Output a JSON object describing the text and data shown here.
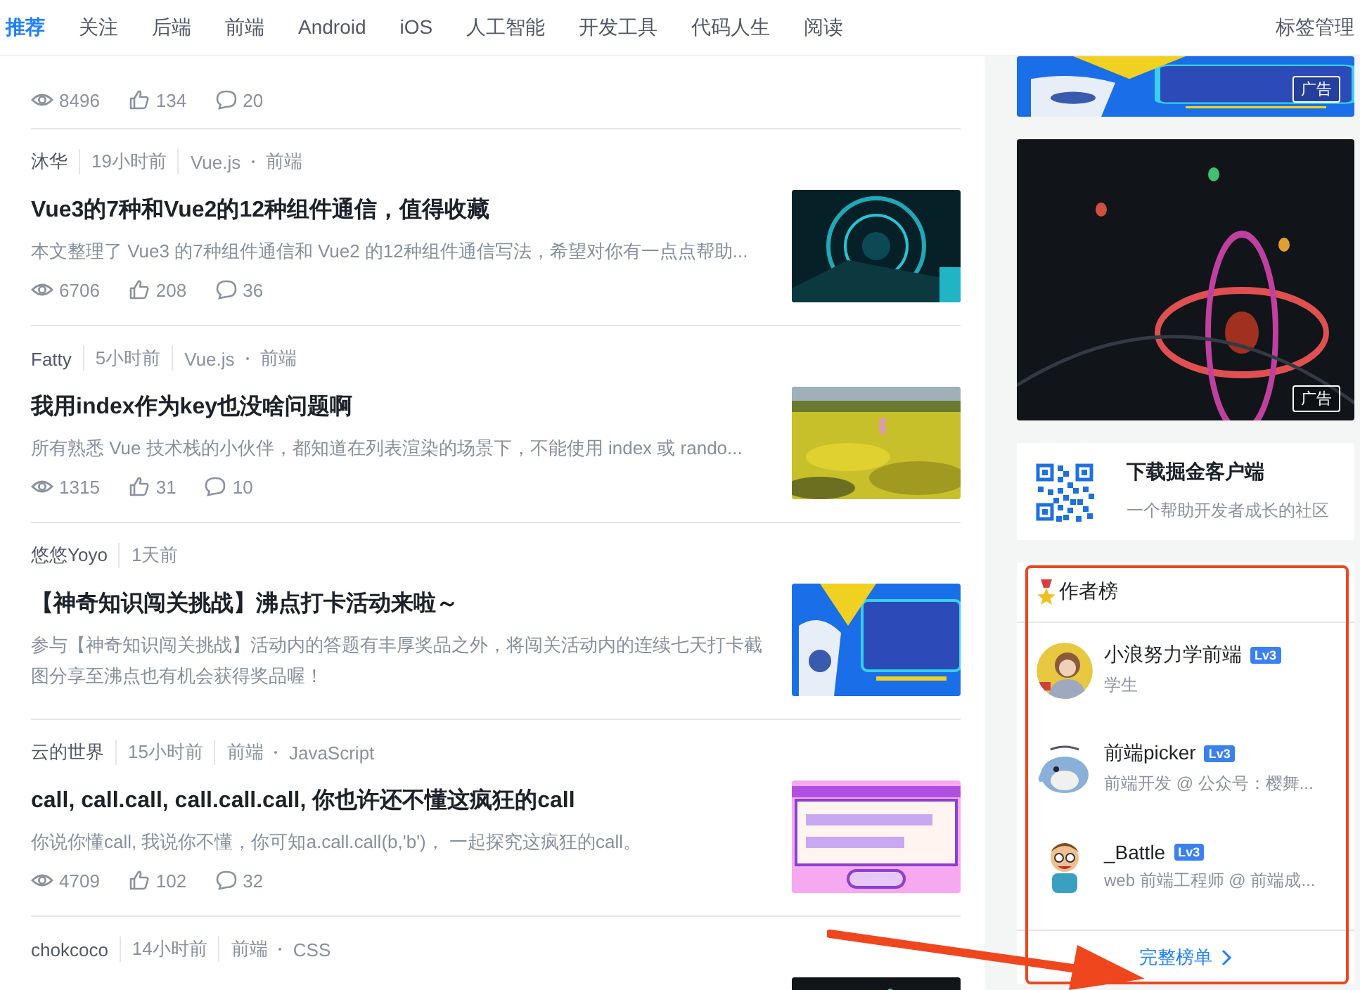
{
  "nav": {
    "tabs": [
      {
        "label": "推荐",
        "selected": true
      },
      {
        "label": "关注",
        "selected": false
      },
      {
        "label": "后端",
        "selected": false
      },
      {
        "label": "前端",
        "selected": false
      },
      {
        "label": "Android",
        "selected": false
      },
      {
        "label": "iOS",
        "selected": false
      },
      {
        "label": "人工智能",
        "selected": false
      },
      {
        "label": "开发工具",
        "selected": false
      },
      {
        "label": "代码人生",
        "selected": false
      },
      {
        "label": "阅读",
        "selected": false
      }
    ],
    "manage": "标签管理"
  },
  "articles": [
    {
      "stats": {
        "views": "8496",
        "likes": "134",
        "comments": "20"
      }
    },
    {
      "author": "沐华",
      "time": "19小时前",
      "tags": [
        "Vue.js",
        "前端"
      ],
      "title": "Vue3的7种和Vue2的12种组件通信，值得收藏",
      "excerpt": "本文整理了 Vue3 的7种组件通信和 Vue2 的12种组件通信写法，希望对你有一点点帮助...",
      "stats": {
        "views": "6706",
        "likes": "208",
        "comments": "36"
      },
      "thumbnail": {
        "kind": "picture"
      }
    },
    {
      "author": "Fatty",
      "time": "5小时前",
      "tags": [
        "Vue.js",
        "前端"
      ],
      "title": "我用index作为key也没啥问题啊",
      "excerpt": "所有熟悉 Vue 技术栈的小伙伴，都知道在列表渲染的场景下，不能使用 index 或 rando...",
      "stats": {
        "views": "1315",
        "likes": "31",
        "comments": "10"
      },
      "thumbnail": {
        "kind": "picture"
      }
    },
    {
      "author": "悠悠Yoyo",
      "time": "1天前",
      "title": "【神奇知识闯关挑战】沸点打卡活动来啦～",
      "excerpt": "参与【神奇知识闯关挑战】活动内的答题有丰厚奖品之外，将闯关活动内的连续七天打卡截图分享至沸点也有机会获得奖品喔！",
      "thumbnail": {
        "kind": "picture"
      }
    },
    {
      "author": "云的世界",
      "time": "15小时前",
      "tags": [
        "前端",
        "JavaScript"
      ],
      "title": "call, call.call, call.call.call, 你也许还不懂这疯狂的call",
      "excerpt": "你说你懂call, 我说你不懂，你可知a.call.call(b,'b')， 一起探究这疯狂的call。",
      "stats": {
        "views": "4709",
        "likes": "102",
        "comments": "32"
      },
      "thumbnail": {
        "kind": "picture"
      }
    },
    {
      "author": "chokcoco",
      "time": "14小时前",
      "tags": [
        "前端",
        "CSS"
      ],
      "thumbnail": {
        "kind": "picture"
      }
    }
  ],
  "sidebar": {
    "ads": [
      {
        "kind": "picture",
        "badge": "广告"
      },
      {
        "kind": "picture",
        "badge": "广告"
      }
    ],
    "app_card": {
      "title": "下载掘金客户端",
      "subtitle": "一个帮助开发者成长的社区"
    },
    "author_rank": {
      "title": "作者榜",
      "highlighted": true,
      "authors": [
        {
          "name": "小浪努力学前端",
          "level_badge": "Lv3",
          "bio": "学生"
        },
        {
          "name": "前端picker",
          "level_badge": "Lv3",
          "bio": "前端开发 @ 公众号：樱舞..."
        },
        {
          "name": "_Battle",
          "level_badge": "Lv3",
          "bio": "web 前端工程师 @ 前端成..."
        }
      ],
      "more": "完整榜单"
    }
  },
  "annotation_arrow": true
}
